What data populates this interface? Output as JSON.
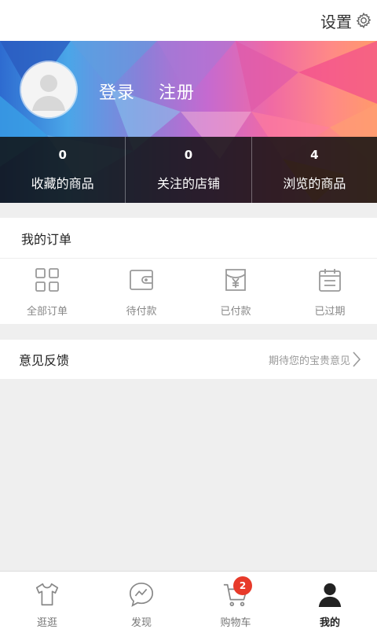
{
  "header": {
    "settings_label": "设置",
    "settings_icon": "gear-icon"
  },
  "profile": {
    "avatar_icon": "default-avatar-icon",
    "login_label": "登录",
    "register_label": "注册",
    "stats": [
      {
        "count": "0",
        "label": "收藏的商品"
      },
      {
        "count": "0",
        "label": "关注的店铺"
      },
      {
        "count": "4",
        "label": "浏览的商品"
      }
    ]
  },
  "orders": {
    "title": "我的订单",
    "items": [
      {
        "label": "全部订单",
        "icon": "grid-icon"
      },
      {
        "label": "待付款",
        "icon": "wallet-icon"
      },
      {
        "label": "已付款",
        "icon": "yen-box-icon"
      },
      {
        "label": "已过期",
        "icon": "calendar-icon"
      }
    ]
  },
  "feedback": {
    "title": "意见反馈",
    "hint": "期待您的宝贵意见"
  },
  "nav": {
    "items": [
      {
        "label": "逛逛",
        "icon": "tshirt-icon"
      },
      {
        "label": "发现",
        "icon": "discover-icon"
      },
      {
        "label": "购物车",
        "icon": "cart-icon"
      },
      {
        "label": "我的",
        "icon": "user-icon"
      }
    ],
    "cart_badge": "2",
    "active": "我的"
  },
  "colors": {
    "badge": "#e73a2a",
    "stats_bg": "#0f0f0f",
    "page_bg": "#efefef"
  }
}
